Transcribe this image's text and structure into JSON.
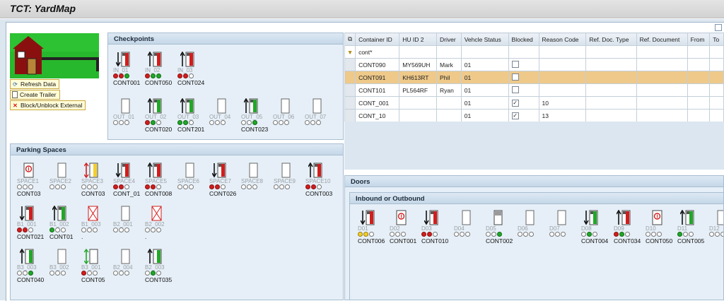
{
  "app": {
    "title": "TCT: YardMap"
  },
  "toolbar": {
    "refresh_label": "Refresh Data",
    "create_label": "Create Trailer",
    "block_label": "Block/Unblock External"
  },
  "checkpoints": {
    "title": "Checkpoints",
    "slots": [
      {
        "label": "IN_01",
        "container": "CONT001",
        "trailer": "red-down",
        "lights": [
          "red",
          "red",
          "grn"
        ]
      },
      {
        "label": "IN_02",
        "container": "CONT050",
        "trailer": "red-up",
        "lights": [
          "red",
          "grn",
          "grn"
        ]
      },
      {
        "label": "IN_03",
        "container": "CONT024",
        "trailer": "red-up",
        "lights": [
          "red",
          "red",
          "off"
        ]
      },
      {
        "label": "OUT_01",
        "container": "",
        "trailer": "empty",
        "lights": [
          "off",
          "off",
          "off"
        ]
      },
      {
        "label": "OUT_02",
        "container": "CONT020",
        "trailer": "green-up",
        "lights": [
          "red",
          "grn",
          "off"
        ]
      },
      {
        "label": "OUT_03",
        "container": "CONT201",
        "trailer": "green-up",
        "lights": [
          "grn",
          "grn",
          "off"
        ]
      },
      {
        "label": "OUT_04",
        "container": "",
        "trailer": "empty",
        "lights": [
          "off",
          "off",
          "off"
        ]
      },
      {
        "label": "OUT_05",
        "container": "CONT023",
        "trailer": "green-up",
        "lights": [
          "off",
          "off",
          "grn"
        ]
      },
      {
        "label": "OUT_06",
        "container": "",
        "trailer": "empty",
        "lights": [
          "off",
          "off",
          "off"
        ]
      },
      {
        "label": "OUT_07",
        "container": "",
        "trailer": "empty",
        "lights": [
          "off",
          "off",
          "off"
        ]
      }
    ]
  },
  "parking": {
    "title": "Parking Spaces",
    "slots": [
      {
        "label": "SPACE1",
        "container": "CONT03",
        "trailer": "red-circle",
        "lights": [
          "off",
          "off",
          "off"
        ]
      },
      {
        "label": "SPACE2",
        "container": "",
        "trailer": "empty",
        "lights": [
          "off",
          "off",
          "off"
        ]
      },
      {
        "label": "SPACE3",
        "container": "CONT03",
        "trailer": "yellow-updown",
        "lights": [
          "off",
          "off",
          "off"
        ]
      },
      {
        "label": "SPACE4",
        "container": "CONT_01",
        "trailer": "red-down",
        "lights": [
          "red",
          "red",
          "off"
        ]
      },
      {
        "label": "SPACE5",
        "container": "CONT008",
        "trailer": "red-up",
        "lights": [
          "red",
          "red",
          "off"
        ]
      },
      {
        "label": "SPACE6",
        "container": "",
        "trailer": "empty",
        "lights": [
          "off",
          "off",
          "off"
        ]
      },
      {
        "label": "SPACE7",
        "container": "CONT026",
        "trailer": "red-down",
        "lights": [
          "red",
          "red",
          "off"
        ]
      },
      {
        "label": "SPACE8",
        "container": "",
        "trailer": "empty",
        "lights": [
          "off",
          "off",
          "off"
        ]
      },
      {
        "label": "SPACE9",
        "container": "",
        "trailer": "empty",
        "lights": [
          "off",
          "off",
          "off"
        ]
      },
      {
        "label": "SPACE10",
        "container": "CONT003",
        "trailer": "red-up",
        "lights": [
          "red",
          "red",
          "off"
        ]
      },
      {
        "label": "B1_001",
        "container": "CONT021",
        "trailer": "red-down",
        "lights": [
          "red",
          "red",
          "off"
        ]
      },
      {
        "label": "B1_002",
        "container": "CONT01",
        "trailer": "green-up",
        "lights": [
          "grn",
          "off",
          "off"
        ]
      },
      {
        "label": "B1_003",
        "container": ".",
        "trailer": "red-x",
        "lights": [
          "off",
          "off",
          "off"
        ]
      },
      {
        "label": "B2_001",
        "container": "",
        "trailer": "empty",
        "lights": [
          "off",
          "off",
          "off"
        ]
      },
      {
        "label": "B2_002",
        "container": ".",
        "trailer": "red-x",
        "lights": [
          "off",
          "off",
          "off"
        ]
      },
      {
        "label": "B3_003",
        "container": "CONT040",
        "trailer": "up-small",
        "lights": [
          "off",
          "off",
          "grn"
        ]
      },
      {
        "label": "B3_002",
        "container": "",
        "trailer": "empty",
        "lights": [
          "off",
          "off",
          "off"
        ]
      },
      {
        "label": "B3_001",
        "container": "CONT05",
        "trailer": "green-updown",
        "lights": [
          "red",
          "off",
          "off"
        ]
      },
      {
        "label": "B2_004",
        "container": "",
        "trailer": "empty",
        "lights": [
          "off",
          "off",
          "off"
        ]
      },
      {
        "label": "B2_003",
        "container": "CONT035",
        "trailer": "up-small",
        "lights": [
          "off",
          "grn",
          "off"
        ]
      }
    ]
  },
  "doors": {
    "title": "Doors",
    "subtitle": "Inbound or Outbound",
    "slots": [
      {
        "label": "D01",
        "container": "CONT006",
        "trailer": "red-down",
        "lights": [
          "yel",
          "yel",
          "off"
        ]
      },
      {
        "label": "D02",
        "container": "CONT001",
        "trailer": "red-circle",
        "lights": [
          "off",
          "off",
          "off"
        ]
      },
      {
        "label": "D03",
        "container": "CONT010",
        "trailer": "red-down",
        "lights": [
          "red",
          "red",
          "off"
        ]
      },
      {
        "label": "D04",
        "container": "",
        "trailer": "empty",
        "lights": [
          "off",
          "off",
          "off"
        ]
      },
      {
        "label": "D05",
        "container": "CONT002",
        "trailer": "grey",
        "lights": [
          "off",
          "off",
          "grn"
        ]
      },
      {
        "label": "D06",
        "container": "",
        "trailer": "empty",
        "lights": [
          "off",
          "off",
          "off"
        ]
      },
      {
        "label": "D07",
        "container": "",
        "trailer": "empty",
        "lights": [
          "off",
          "off",
          "off"
        ]
      },
      {
        "label": "D08",
        "container": "CONT004",
        "trailer": "green-down",
        "lights": [
          "off",
          "grn",
          "off"
        ]
      },
      {
        "label": "D09",
        "container": "CONT034",
        "trailer": "red-up",
        "lights": [
          "red",
          "grn",
          "off"
        ]
      },
      {
        "label": "D10",
        "container": "CONT050",
        "trailer": "red-circle",
        "lights": [
          "off",
          "off",
          "off"
        ]
      },
      {
        "label": "D11",
        "container": "CONT005",
        "trailer": "green-up",
        "lights": [
          "grn",
          "off",
          "off"
        ]
      },
      {
        "label": "D12",
        "container": "",
        "trailer": "empty",
        "lights": [
          "off",
          "off",
          "off"
        ]
      }
    ]
  },
  "table": {
    "columns": [
      "Container ID",
      "HU ID 2",
      "Driver",
      "Vehcle Status",
      "Blocked",
      "Reason Code",
      "Ref. Doc. Type",
      "Ref. Document",
      "From",
      "To"
    ],
    "filter": "cont*",
    "rows": [
      {
        "cells": [
          "CONT090",
          "MY569UH",
          "Mark",
          "01",
          "",
          "",
          "",
          "",
          "",
          ""
        ],
        "blocked": false,
        "selected": false
      },
      {
        "cells": [
          "CONT091",
          "KH613RT",
          "Phil",
          "01",
          "",
          "",
          "",
          "",
          "",
          ""
        ],
        "blocked": false,
        "selected": true
      },
      {
        "cells": [
          "CONT101",
          "PL564RF",
          "Ryan",
          "01",
          "",
          "",
          "",
          "",
          "",
          ""
        ],
        "blocked": false,
        "selected": false
      },
      {
        "cells": [
          "CONT_001",
          "",
          "",
          "01",
          "",
          "10",
          "",
          "",
          "",
          ""
        ],
        "blocked": true,
        "selected": false
      },
      {
        "cells": [
          "CONT_10",
          "",
          "",
          "01",
          "",
          "13",
          "",
          "",
          "",
          ""
        ],
        "blocked": true,
        "selected": false
      }
    ]
  }
}
